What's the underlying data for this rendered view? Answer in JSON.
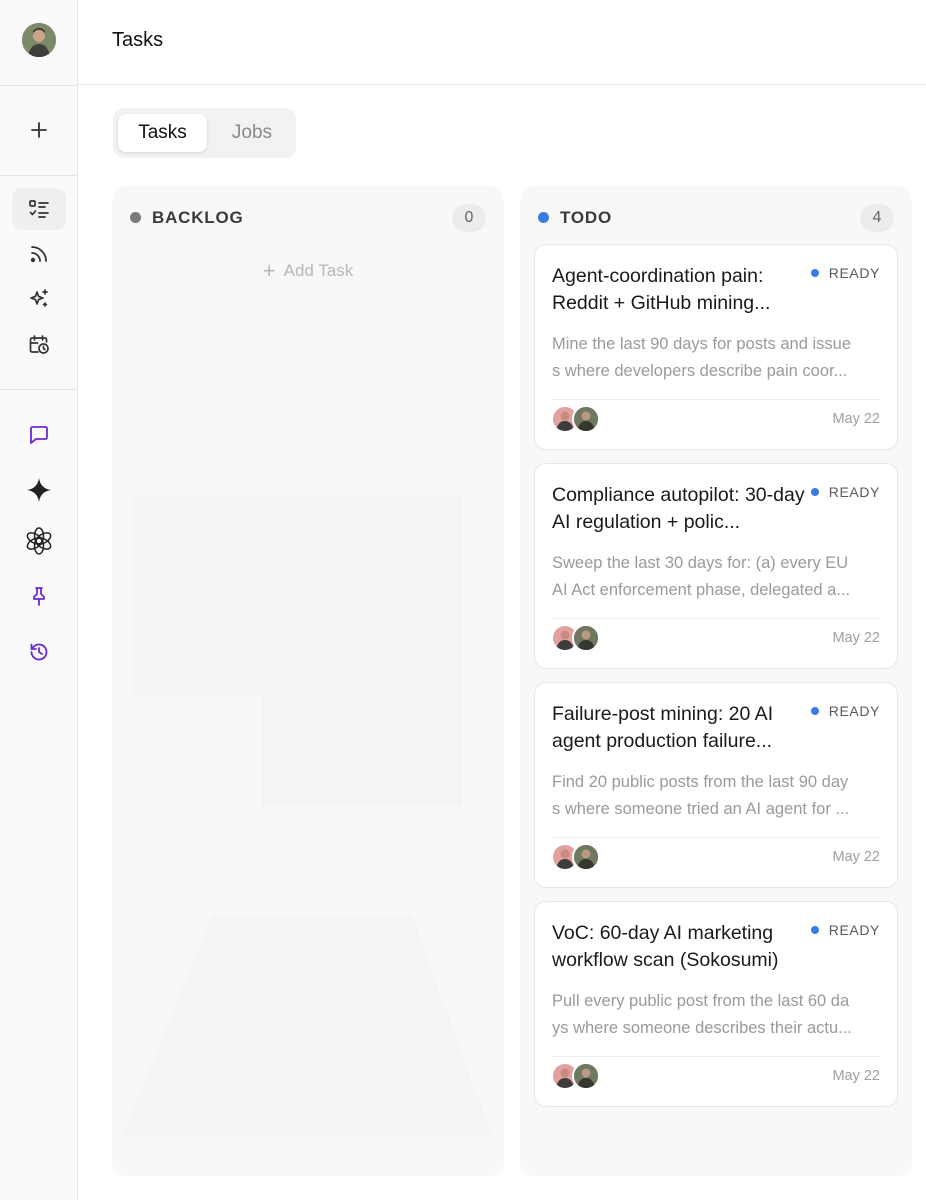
{
  "header": {
    "title": "Tasks"
  },
  "tabs": [
    {
      "label": "Tasks",
      "active": true
    },
    {
      "label": "Jobs",
      "active": false
    }
  ],
  "sidebar": {
    "items": [
      {
        "icon": "plus-icon"
      },
      {
        "icon": "task-list-icon",
        "active": true
      },
      {
        "icon": "rss-icon"
      },
      {
        "icon": "sparkles-icon"
      },
      {
        "icon": "calendar-clock-icon"
      },
      {
        "icon": "chat-icon",
        "color": "#6d28d9"
      },
      {
        "icon": "gemini-star-icon"
      },
      {
        "icon": "openai-icon"
      },
      {
        "icon": "pin-icon",
        "color": "#6d28d9"
      },
      {
        "icon": "history-icon",
        "color": "#6d28d9"
      }
    ]
  },
  "columns": [
    {
      "name": "BACKLOG",
      "count": "0",
      "dot_color": "#7a7a7a",
      "add_label": "Add Task",
      "cards": []
    },
    {
      "name": "TODO",
      "count": "4",
      "dot_color": "#3b7ae6",
      "cards": [
        {
          "title": "Agent-coordination pain: Reddit + GitHub mining...",
          "status": "READY",
          "desc_line1": "Mine the last 90 days for posts and issue",
          "desc_line2": "s where developers describe pain coor...",
          "date": "May 22"
        },
        {
          "title": "Compliance autopilot: 30-day AI regulation + polic...",
          "status": "READY",
          "desc_line1": "Sweep the last 30 days for: (a) every EU",
          "desc_line2": "AI Act enforcement phase, delegated a...",
          "date": "May 22"
        },
        {
          "title": "Failure-post mining: 20 AI agent production failure...",
          "status": "READY",
          "desc_line1": "Find 20 public posts from the last 90 day",
          "desc_line2": "s where someone tried an AI agent for ...",
          "date": "May 22"
        },
        {
          "title": "VoC: 60-day AI marketing workflow scan (Sokosumi)",
          "status": "READY",
          "desc_line1": "Pull every public post from the last 60 da",
          "desc_line2": "ys where someone describes their actu...",
          "date": "May 22"
        }
      ]
    }
  ],
  "colors": {
    "accent_purple": "#6d28d9",
    "ready_blue": "#3b7ae6"
  }
}
